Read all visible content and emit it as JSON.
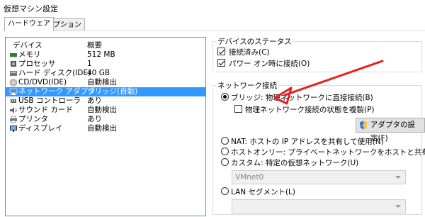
{
  "window": {
    "title": "仮想マシン設定"
  },
  "tabs": [
    {
      "label": "ハードウェア"
    },
    {
      "label": "オプション"
    }
  ],
  "device_list": {
    "header": {
      "device": "デバイス",
      "summary": "概要"
    },
    "rows": [
      {
        "name": "メモリ",
        "summary": "512 MB",
        "icon": "memory-icon"
      },
      {
        "name": "プロセッサ",
        "summary": "1",
        "icon": "processor-icon"
      },
      {
        "name": "ハード ディスク(IDE)",
        "summary": "40 GB",
        "icon": "hard-disk-icon"
      },
      {
        "name": "CD/DVD(IDE)",
        "summary": "自動検出",
        "icon": "cd-dvd-icon"
      },
      {
        "name": "ネットワーク アダプタ",
        "summary": "ブリッジ(自動)",
        "icon": "network-adapter-icon"
      },
      {
        "name": "USB コントローラ",
        "summary": "あり",
        "icon": "usb-icon"
      },
      {
        "name": "サウンド カード",
        "summary": "自動検出",
        "icon": "sound-card-icon"
      },
      {
        "name": "プリンタ",
        "summary": "あり",
        "icon": "printer-icon"
      },
      {
        "name": "ディスプレイ",
        "summary": "自動検出",
        "icon": "display-icon"
      }
    ],
    "selected_index": 4
  },
  "device_status": {
    "title": "デバイスのステータス",
    "connected": {
      "label": "接続済み(C)",
      "checked": true
    },
    "connect_on_power": {
      "label": "パワー オン時に接続(O)",
      "checked": true
    }
  },
  "network_connection": {
    "title": "ネットワーク接続",
    "bridge": {
      "label": "ブリッジ: 物理ネットワークに直接接続(B)",
      "checked": true
    },
    "replicate": {
      "label": "物理ネットワーク接続の状態を複製(P)",
      "checked": false
    },
    "adapter_settings_button": "アダプタの設定(F)",
    "nat": {
      "label": "NAT: ホストの IP アドレスを共有して使用(N)"
    },
    "host_only": {
      "label": "ホストオンリー: プライベートネットワークをホストと共有(H)"
    },
    "custom": {
      "label": "カスタム: 特定の仮想ネットワーク(U)"
    },
    "vmnet_select": {
      "value": "VMnet0"
    },
    "lan_segment": {
      "label": "LAN セグメント(L)"
    },
    "lan_select": {
      "value": ""
    }
  },
  "colors": {
    "selection": "#3399ff",
    "annotation_arrow": "#e52020"
  }
}
